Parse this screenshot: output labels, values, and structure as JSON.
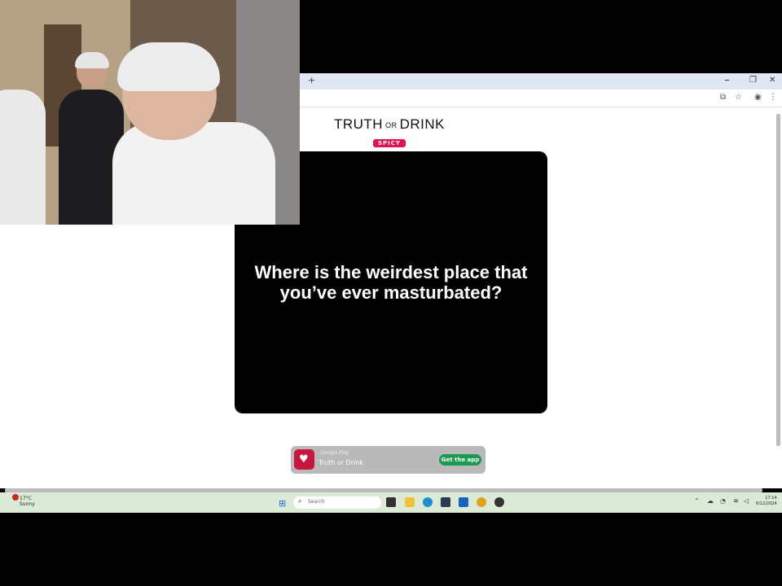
{
  "site": {
    "logo_main": "TRUTH",
    "logo_or": "OR",
    "logo_end": "DRINK",
    "badge": "SPICY"
  },
  "card": {
    "question_line1": "Where is the weirdest place that",
    "question_line2": "you’ve ever masturbated?"
  },
  "app_banner": {
    "store": "Google Play",
    "app_name": "Truth or Drink",
    "button": "Get the app"
  },
  "browser": {
    "new_tab": "+",
    "minimize": "⎯",
    "restore": "❐",
    "close": "✕"
  },
  "taskbar": {
    "weather_temp": "17°C",
    "weather_desc": "Sunny",
    "search_placeholder": "Search",
    "time": "17:14",
    "date": "6/12/2024"
  },
  "colors": {
    "badge": "#e0134f",
    "get_app": "#1a9b51",
    "card": "#000000",
    "taskbar": "#dcebd7"
  }
}
